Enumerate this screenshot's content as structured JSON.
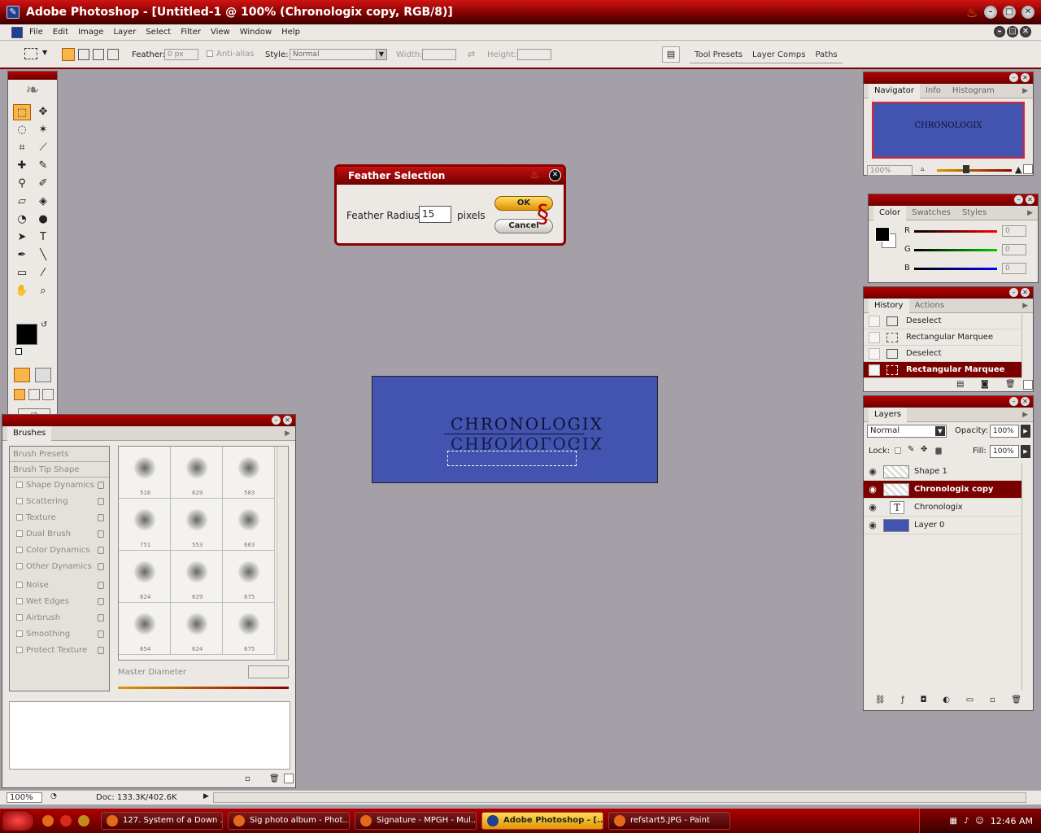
{
  "window": {
    "title": "Adobe Photoshop - [Untitled-1 @ 100% (Chronologix copy, RGB/8)]"
  },
  "menu": [
    "File",
    "Edit",
    "Image",
    "Layer",
    "Select",
    "Filter",
    "View",
    "Window",
    "Help"
  ],
  "options": {
    "feather_label": "Feather:",
    "feather_value": "0 px",
    "antialias_label": "Anti-alias",
    "style_label": "Style:",
    "style_value": "Normal",
    "width_label": "Width:",
    "height_label": "Height:",
    "well_tabs": [
      "Tool Presets",
      "Layer Comps",
      "Paths"
    ]
  },
  "dialog": {
    "title": "Feather Selection",
    "radius_label": "Feather Radius:",
    "radius_value": "15",
    "unit": "pixels",
    "ok": "OK",
    "cancel": "Cancel"
  },
  "canvas": {
    "text1": "CHRONOLOGIX",
    "text2": "CHRONOLOGIX",
    "bg_color": "#4254b0"
  },
  "navigator": {
    "tabs": [
      "Navigator",
      "Info",
      "Histogram"
    ],
    "zoom": "100%"
  },
  "color": {
    "tabs": [
      "Color",
      "Swatches",
      "Styles"
    ],
    "r_label": "R",
    "g_label": "G",
    "b_label": "B",
    "r": "0",
    "g": "0",
    "b": "0"
  },
  "history": {
    "tabs": [
      "History",
      "Actions"
    ],
    "items": [
      "Deselect",
      "Rectangular Marquee",
      "Deselect",
      "Rectangular Marquee"
    ]
  },
  "layers": {
    "tab": "Layers",
    "blend_mode": "Normal",
    "opacity_label": "Opacity:",
    "opacity": "100%",
    "lock_label": "Lock:",
    "fill_label": "Fill:",
    "fill": "100%",
    "items": [
      {
        "name": "Shape 1",
        "selected": false
      },
      {
        "name": "Chronologix copy",
        "selected": true
      },
      {
        "name": "Chronologix",
        "selected": false
      },
      {
        "name": "Layer 0",
        "selected": false
      }
    ]
  },
  "brushes": {
    "tab": "Brushes",
    "options": [
      "Brush Presets",
      "Brush Tip Shape",
      "Shape Dynamics",
      "Scattering",
      "Texture",
      "Dual Brush",
      "Color Dynamics",
      "Other Dynamics",
      "Noise",
      "Wet Edges",
      "Airbrush",
      "Smoothing",
      "Protect Texture"
    ],
    "sizes": [
      "516",
      "629",
      "583",
      "751",
      "553",
      "663",
      "624",
      "629",
      "675",
      "654",
      "624",
      "675"
    ],
    "master_diameter_label": "Master Diameter"
  },
  "status": {
    "zoom": "100%",
    "doc": "Doc: 133.3K/402.6K"
  },
  "taskbar": {
    "items": [
      {
        "label": "127. System of a Down ...",
        "active": false
      },
      {
        "label": "Sig photo album - Phot...",
        "active": false
      },
      {
        "label": "Signature - MPGH - Mul...",
        "active": false
      },
      {
        "label": "Adobe Photoshop - [...",
        "active": true
      },
      {
        "label": "refstart5.JPG - Paint",
        "active": false
      }
    ],
    "clock": "12:46 AM"
  },
  "colors": {
    "accent": "#8a0000",
    "selection": "#7a0000",
    "doc_bg": "#4254b0",
    "workspace": "#a59fa7"
  }
}
